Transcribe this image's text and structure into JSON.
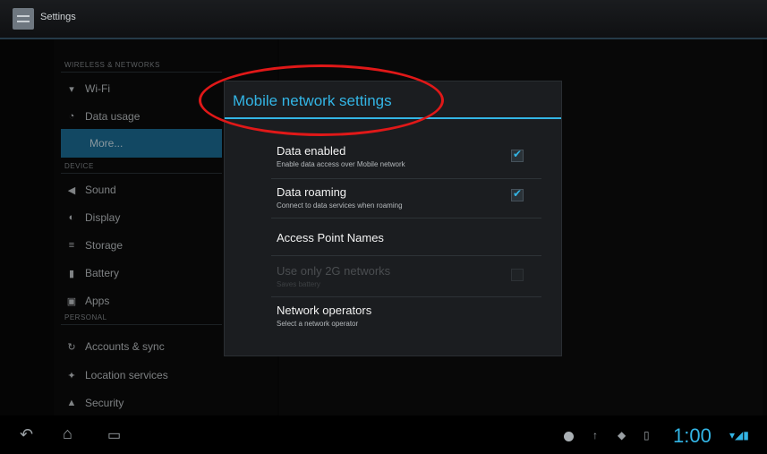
{
  "action_bar": {
    "title": "Settings",
    "icon": "settings-icon"
  },
  "sidebar": {
    "categories": {
      "wireless": "WIRELESS & NETWORKS",
      "device": "DEVICE",
      "personal": "PERSONAL"
    },
    "items": [
      {
        "label": "Wi-Fi",
        "icon": "wifi-icon"
      },
      {
        "label": "Data usage",
        "icon": "data-usage-icon"
      },
      {
        "label": "More...",
        "icon": ""
      },
      {
        "label": "Sound",
        "icon": "sound-icon"
      },
      {
        "label": "Display",
        "icon": "display-icon"
      },
      {
        "label": "Storage",
        "icon": "storage-icon"
      },
      {
        "label": "Battery",
        "icon": "battery-icon"
      },
      {
        "label": "Apps",
        "icon": "apps-icon"
      },
      {
        "label": "Accounts & sync",
        "icon": "sync-icon"
      },
      {
        "label": "Location services",
        "icon": "location-icon"
      },
      {
        "label": "Security",
        "icon": "lock-icon"
      }
    ]
  },
  "dialog": {
    "title": "Mobile network settings",
    "prefs": [
      {
        "title": "Data enabled",
        "summary": "Enable data access over Mobile network",
        "checked": true
      },
      {
        "title": "Data roaming",
        "summary": "Connect to data services when roaming",
        "checked": true
      },
      {
        "title": "Access Point Names",
        "summary": ""
      },
      {
        "title": "Use only 2G networks",
        "summary": "Saves battery",
        "checked": false,
        "disabled": true
      },
      {
        "title": "Network operators",
        "summary": "Select a network operator"
      }
    ]
  },
  "system_bar": {
    "clock": "1:00"
  },
  "colors": {
    "accent": "#33b5e5",
    "annotation": "#e01818",
    "selected": "#1d6f98"
  }
}
